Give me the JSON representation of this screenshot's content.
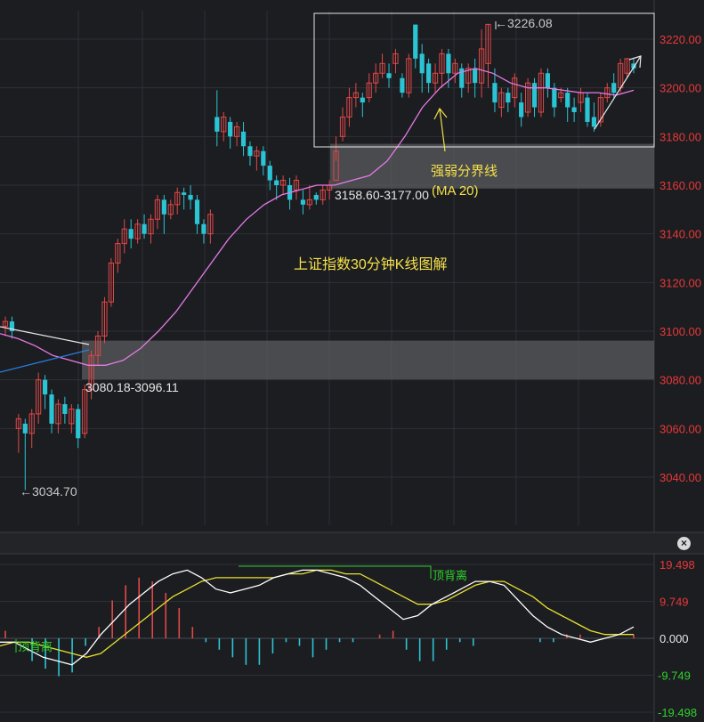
{
  "colors": {
    "background": "#1c1d21",
    "grid": "#2e3036",
    "up": "#e04848",
    "down": "#2bc4d4",
    "ma20": "#e57ae5",
    "annotation": "#f4e04a",
    "price_axis_text": "#e83838",
    "macd_dif": "#ffffff",
    "macd_dea": "#e8e030",
    "divergence": "#2ed12e",
    "zone": "#5a5b5e",
    "trend_blue": "#2a7de0"
  },
  "annotations": {
    "title": "上证指数30分钟K线图解",
    "ma_label_line1": "强弱分界线",
    "ma_label_line2": "(MA 20)",
    "upper_zone": "3158.60-3177.00",
    "lower_zone": "3080.18-3096.11",
    "high": "←3226.08",
    "low": "←3034.70",
    "divergence_top": "顶背离",
    "divergence_bottom": "顶背离"
  },
  "close_button": "×",
  "chart_data": [
    {
      "type": "candlestick",
      "y_ticks": [
        "3220.00",
        "3200.00",
        "3180.00",
        "3160.00",
        "3140.00",
        "3120.00",
        "3100.00",
        "3080.00",
        "3060.00",
        "3040.00"
      ],
      "ylim": [
        3025,
        3233
      ],
      "zones": [
        {
          "label": "3158.60-3177.00",
          "low": 3158.6,
          "high": 3177.0
        },
        {
          "label": "3080.18-3096.11",
          "low": 3080.18,
          "high": 3096.11
        }
      ],
      "annotated_high": 3226.08,
      "annotated_low": 3034.7,
      "candles": [
        [
          3102,
          3104,
          3098,
          3106
        ],
        [
          3104,
          3100,
          3097,
          3106
        ],
        [
          3060,
          3064,
          3050,
          3066
        ],
        [
          3062,
          3058,
          3034.7,
          3064
        ],
        [
          3058,
          3066,
          3052,
          3068
        ],
        [
          3066,
          3080,
          3062,
          3083
        ],
        [
          3080,
          3074,
          3068,
          3082
        ],
        [
          3074,
          3062,
          3058,
          3076
        ],
        [
          3062,
          3070,
          3058,
          3072
        ],
        [
          3070,
          3066,
          3062,
          3073
        ],
        [
          3062,
          3068,
          3058,
          3070
        ],
        [
          3068,
          3056,
          3052,
          3070
        ],
        [
          3058,
          3076,
          3056,
          3078
        ],
        [
          3076,
          3090,
          3072,
          3092
        ],
        [
          3090,
          3098,
          3086,
          3100
        ],
        [
          3098,
          3112,
          3095,
          3114
        ],
        [
          3112,
          3128,
          3110,
          3130
        ],
        [
          3128,
          3136,
          3124,
          3138
        ],
        [
          3136,
          3142,
          3132,
          3146
        ],
        [
          3142,
          3138,
          3134,
          3146
        ],
        [
          3138,
          3144,
          3136,
          3146
        ],
        [
          3144,
          3140,
          3138,
          3148
        ],
        [
          3140,
          3146,
          3136,
          3148
        ],
        [
          3146,
          3154,
          3142,
          3156
        ],
        [
          3154,
          3148,
          3140,
          3156
        ],
        [
          3148,
          3152,
          3146,
          3154
        ],
        [
          3152,
          3157,
          3148,
          3159
        ],
        [
          3157,
          3156,
          3150,
          3159
        ],
        [
          3156,
          3154,
          3150,
          3160
        ],
        [
          3154,
          3144,
          3140,
          3156
        ],
        [
          3144,
          3140,
          3136,
          3146
        ],
        [
          3140,
          3148,
          3136,
          3150
        ],
        [
          3188,
          3182,
          3176,
          3199
        ],
        [
          3182,
          3188,
          3178,
          3190
        ],
        [
          3186,
          3180,
          3175,
          3188
        ],
        [
          3180,
          3184,
          3176,
          3186
        ],
        [
          3182,
          3176,
          3172,
          3186
        ],
        [
          3176,
          3172,
          3168,
          3178
        ],
        [
          3172,
          3174,
          3166,
          3176
        ],
        [
          3174,
          3168,
          3164,
          3176
        ],
        [
          3168,
          3162,
          3158,
          3170
        ],
        [
          3162,
          3160,
          3154,
          3164
        ],
        [
          3160,
          3162,
          3156,
          3164
        ],
        [
          3160,
          3154,
          3150,
          3163
        ],
        [
          3158,
          3162,
          3154,
          3164
        ],
        [
          3154,
          3152,
          3148,
          3158
        ],
        [
          3152,
          3154,
          3150,
          3160
        ],
        [
          3156,
          3154,
          3152,
          3157
        ],
        [
          3154,
          3158,
          3152,
          3160
        ],
        [
          3158,
          3160,
          3154,
          3162
        ],
        [
          3162,
          3174,
          3170,
          3180
        ],
        [
          3180,
          3188,
          3178,
          3192
        ],
        [
          3188,
          3196,
          3184,
          3200
        ],
        [
          3196,
          3198,
          3192,
          3202
        ],
        [
          3196,
          3194,
          3188,
          3198
        ],
        [
          3196,
          3202,
          3194,
          3206
        ],
        [
          3202,
          3206,
          3198,
          3210
        ],
        [
          3206,
          3210,
          3204,
          3214
        ],
        [
          3206,
          3204,
          3200,
          3210
        ],
        [
          3210,
          3214,
          3206,
          3216
        ],
        [
          3204,
          3198,
          3196,
          3206
        ],
        [
          3198,
          3212,
          3196,
          3214
        ],
        [
          3226,
          3212,
          3208,
          3226
        ],
        [
          3214,
          3206,
          3198,
          3218
        ],
        [
          3210,
          3202,
          3198,
          3212
        ],
        [
          3202,
          3206,
          3198,
          3210
        ],
        [
          3206,
          3214,
          3200,
          3216
        ],
        [
          3214,
          3206,
          3200,
          3216
        ],
        [
          3206,
          3210,
          3202,
          3212
        ],
        [
          3208,
          3200,
          3196,
          3210
        ],
        [
          3202,
          3208,
          3198,
          3210
        ],
        [
          3208,
          3202,
          3196,
          3212
        ],
        [
          3202,
          3216,
          3196,
          3224
        ],
        [
          3210,
          3226.08,
          3200,
          3226.08
        ],
        [
          3202,
          3194,
          3190,
          3208
        ],
        [
          3192,
          3198,
          3188,
          3200
        ],
        [
          3198,
          3194,
          3190,
          3200
        ],
        [
          3196,
          3204,
          3192,
          3206
        ],
        [
          3194,
          3188,
          3184,
          3198
        ],
        [
          3190,
          3202,
          3188,
          3204
        ],
        [
          3202,
          3192,
          3188,
          3204
        ],
        [
          3190,
          3206,
          3188,
          3208
        ],
        [
          3206,
          3200,
          3196,
          3208
        ],
        [
          3200,
          3192,
          3188,
          3202
        ],
        [
          3196,
          3198,
          3194,
          3200
        ],
        [
          3198,
          3192,
          3186,
          3200
        ],
        [
          3192,
          3190,
          3186,
          3196
        ],
        [
          3194,
          3198,
          3190,
          3200
        ],
        [
          3196,
          3186,
          3184,
          3198
        ],
        [
          3188,
          3184,
          3182,
          3194
        ],
        [
          3186,
          3196,
          3184,
          3198
        ],
        [
          3196,
          3200,
          3194,
          3202
        ],
        [
          3202,
          3198,
          3196,
          3206
        ],
        [
          3200,
          3210,
          3198,
          3212
        ],
        [
          3206,
          3212,
          3204,
          3212
        ],
        [
          3210,
          3208,
          3206,
          3212
        ]
      ],
      "ma20": [
        3099,
        3097,
        3094,
        3090,
        3088,
        3086,
        3086,
        3088,
        3093,
        3100,
        3108,
        3118,
        3128,
        3138,
        3146,
        3152,
        3156,
        3158,
        3160,
        3160,
        3162,
        3164,
        3170,
        3180,
        3192,
        3200,
        3206,
        3208,
        3206,
        3202,
        3200,
        3200,
        3199,
        3198,
        3198,
        3197,
        3199
      ]
    },
    {
      "type": "macd",
      "y_ticks": [
        "19.498",
        "9.749",
        "0.000",
        "-9.749",
        "-19.498"
      ],
      "ylim": [
        -19.498,
        19.498
      ],
      "dif": [
        -1,
        -1,
        -3,
        -5,
        -6,
        -7,
        -4,
        1,
        5,
        9,
        12,
        15,
        17,
        18,
        16,
        13,
        12,
        13,
        14,
        16,
        17,
        18,
        18,
        17,
        16,
        14,
        11,
        8,
        5,
        6,
        9,
        11,
        13,
        15,
        15,
        14,
        10,
        6,
        3,
        1,
        0,
        -1,
        0,
        1,
        3
      ],
      "dea": [
        -2,
        -1,
        -1,
        -2,
        -3,
        -4,
        -5,
        -4,
        -1,
        2,
        5,
        8,
        11,
        13,
        15,
        16,
        16,
        16,
        16,
        16,
        17,
        17,
        18,
        18,
        17,
        17,
        15,
        13,
        11,
        9,
        9,
        10,
        12,
        14,
        15,
        15,
        13,
        11,
        8,
        6,
        4,
        2,
        1,
        1,
        1
      ],
      "histogram": [
        2,
        0,
        -6,
        -8,
        -10,
        -9,
        -2,
        3,
        10,
        14,
        16,
        15,
        12,
        8,
        3,
        -1,
        -3,
        -5,
        -7,
        -7,
        -4,
        -1,
        -2,
        -5,
        -3,
        -1,
        -1,
        0,
        1,
        2,
        -3,
        -6,
        -6,
        -3,
        -1,
        -2,
        0,
        0,
        0,
        0,
        -1,
        -1,
        1,
        1,
        0,
        0,
        0,
        1
      ],
      "divergence_labels": [
        "顶背离",
        "顶背离"
      ]
    }
  ]
}
